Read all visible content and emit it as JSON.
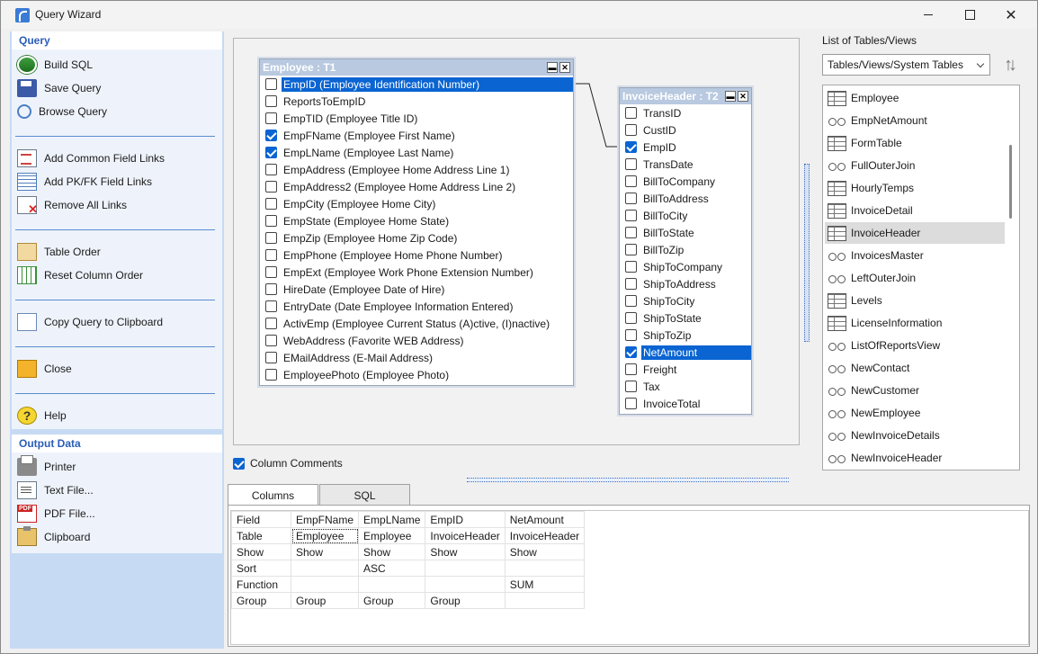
{
  "window": {
    "title": "Query Wizard"
  },
  "sidebar": {
    "query_header": "Query",
    "query_items": [
      {
        "label": "Build SQL",
        "icon": "build-sql-icon"
      },
      {
        "label": "Save Query",
        "icon": "save-icon"
      },
      {
        "label": "Browse Query",
        "icon": "browse-icon"
      },
      {
        "label": "Add Common Field Links",
        "icon": "common-links-icon"
      },
      {
        "label": "Add PK/FK Field Links",
        "icon": "pkfk-links-icon"
      },
      {
        "label": "Remove All Links",
        "icon": "remove-links-icon"
      },
      {
        "label": "Table Order",
        "icon": "table-order-icon"
      },
      {
        "label": "Reset Column Order",
        "icon": "reset-columns-icon"
      },
      {
        "label": "Copy Query to Clipboard",
        "icon": "copy-icon"
      },
      {
        "label": "Close",
        "icon": "close-folder-icon"
      },
      {
        "label": "Help",
        "icon": "help-icon"
      }
    ],
    "output_header": "Output Data",
    "output_items": [
      {
        "label": "Printer",
        "icon": "printer-icon"
      },
      {
        "label": "Text File...",
        "icon": "text-file-icon"
      },
      {
        "label": "PDF File...",
        "icon": "pdf-file-icon"
      },
      {
        "label": "Clipboard",
        "icon": "clipboard-icon"
      }
    ]
  },
  "employee_table": {
    "title": "Employee : T1",
    "fields": [
      {
        "text": "EmpID  (Employee Identification Number)",
        "checked": false,
        "selected": true
      },
      {
        "text": "ReportsToEmpID",
        "checked": false
      },
      {
        "text": "EmpTID  (Employee Title ID)",
        "checked": false
      },
      {
        "text": "EmpFName  (Employee First Name)",
        "checked": true
      },
      {
        "text": "EmpLName  (Employee Last Name)",
        "checked": true
      },
      {
        "text": "EmpAddress  (Employee Home Address Line 1)",
        "checked": false
      },
      {
        "text": "EmpAddress2  (Employee Home Address Line 2)",
        "checked": false
      },
      {
        "text": "EmpCity  (Employee Home City)",
        "checked": false
      },
      {
        "text": "EmpState  (Employee Home State)",
        "checked": false
      },
      {
        "text": "EmpZip  (Employee Home Zip Code)",
        "checked": false
      },
      {
        "text": "EmpPhone  (Employee Home Phone Number)",
        "checked": false
      },
      {
        "text": "EmpExt  (Employee Work Phone Extension Number)",
        "checked": false
      },
      {
        "text": "HireDate  (Employee Date of Hire)",
        "checked": false
      },
      {
        "text": "EntryDate  (Date Employee Information Entered)",
        "checked": false
      },
      {
        "text": "ActivEmp  (Employee Current Status (A)ctive, (I)nactive)",
        "checked": false
      },
      {
        "text": "WebAddress  (Favorite WEB Address)",
        "checked": false
      },
      {
        "text": "EMailAddress  (E-Mail Address)",
        "checked": false
      },
      {
        "text": "EmployeePhoto  (Employee Photo)",
        "checked": false
      }
    ]
  },
  "invoice_table": {
    "title": "InvoiceHeader : T2",
    "fields": [
      {
        "text": "TransID",
        "checked": false
      },
      {
        "text": "CustID",
        "checked": false
      },
      {
        "text": "EmpID",
        "checked": true
      },
      {
        "text": "TransDate",
        "checked": false
      },
      {
        "text": "BillToCompany",
        "checked": false
      },
      {
        "text": "BillToAddress",
        "checked": false
      },
      {
        "text": "BillToCity",
        "checked": false
      },
      {
        "text": "BillToState",
        "checked": false
      },
      {
        "text": "BillToZip",
        "checked": false
      },
      {
        "text": "ShipToCompany",
        "checked": false
      },
      {
        "text": "ShipToAddress",
        "checked": false
      },
      {
        "text": "ShipToCity",
        "checked": false
      },
      {
        "text": "ShipToState",
        "checked": false
      },
      {
        "text": "ShipToZip",
        "checked": false
      },
      {
        "text": "NetAmount",
        "checked": true,
        "selected": true
      },
      {
        "text": "Freight",
        "checked": false
      },
      {
        "text": "Tax",
        "checked": false
      },
      {
        "text": "InvoiceTotal",
        "checked": false
      }
    ]
  },
  "tables_panel": {
    "label": "List of Tables/Views",
    "filter_value": "Tables/Views/System Tables",
    "items": [
      {
        "name": "Employee",
        "kind": "table"
      },
      {
        "name": "EmpNetAmount",
        "kind": "view"
      },
      {
        "name": "FormTable",
        "kind": "table"
      },
      {
        "name": "FullOuterJoin",
        "kind": "view"
      },
      {
        "name": "HourlyTemps",
        "kind": "table"
      },
      {
        "name": "InvoiceDetail",
        "kind": "table"
      },
      {
        "name": "InvoiceHeader",
        "kind": "table",
        "selected": true
      },
      {
        "name": "InvoicesMaster",
        "kind": "view"
      },
      {
        "name": "LeftOuterJoin",
        "kind": "view"
      },
      {
        "name": "Levels",
        "kind": "table"
      },
      {
        "name": "LicenseInformation",
        "kind": "table"
      },
      {
        "name": "ListOfReportsView",
        "kind": "view"
      },
      {
        "name": "NewContact",
        "kind": "view"
      },
      {
        "name": "NewCustomer",
        "kind": "view"
      },
      {
        "name": "NewEmployee",
        "kind": "view"
      },
      {
        "name": "NewInvoiceDetails",
        "kind": "view"
      },
      {
        "name": "NewInvoiceHeader",
        "kind": "view"
      }
    ]
  },
  "column_comments": {
    "label": "Column Comments",
    "checked": true
  },
  "tabs": [
    {
      "label": "Columns",
      "active": true
    },
    {
      "label": "SQL",
      "active": false
    }
  ],
  "columns_grid": {
    "rows": [
      [
        "Field",
        "EmpFName",
        "EmpLName",
        "EmpID",
        "NetAmount"
      ],
      [
        "Table",
        "Employee",
        "Employee",
        "InvoiceHeader",
        "InvoiceHeader"
      ],
      [
        "Show",
        "Show",
        "Show",
        "Show",
        "Show"
      ],
      [
        "Sort",
        "",
        "ASC",
        "",
        ""
      ],
      [
        "Function",
        "",
        "",
        "",
        "SUM"
      ],
      [
        "Group",
        "Group",
        "Group",
        "Group",
        ""
      ]
    ]
  }
}
